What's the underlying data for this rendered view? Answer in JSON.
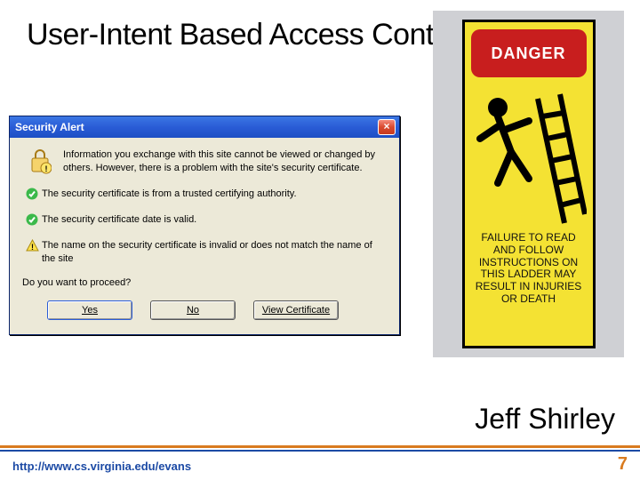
{
  "slide": {
    "title": "User-Intent Based Access Control",
    "author": "Jeff Shirley",
    "footer_url": "http://www.cs.virginia.edu/evans",
    "page_number": "7"
  },
  "dialog": {
    "title": "Security Alert",
    "intro": "Information you exchange with this site cannot be viewed or changed by others. However, there is a problem with the site's security certificate.",
    "items": [
      {
        "status": "ok",
        "text": "The security certificate is from a trusted certifying authority."
      },
      {
        "status": "ok",
        "text": "The security certificate date is valid."
      },
      {
        "status": "warn",
        "text": "The name on the security certificate is invalid or does not match the name of the site"
      }
    ],
    "proceed": "Do you want to proceed?",
    "buttons": {
      "yes": "Yes",
      "no": "No",
      "view": "View Certificate"
    }
  },
  "sign": {
    "danger": "DANGER",
    "warning": "FAILURE TO READ AND FOLLOW INSTRUCTIONS ON THIS LADDER MAY RESULT IN INJURIES OR DEATH"
  }
}
